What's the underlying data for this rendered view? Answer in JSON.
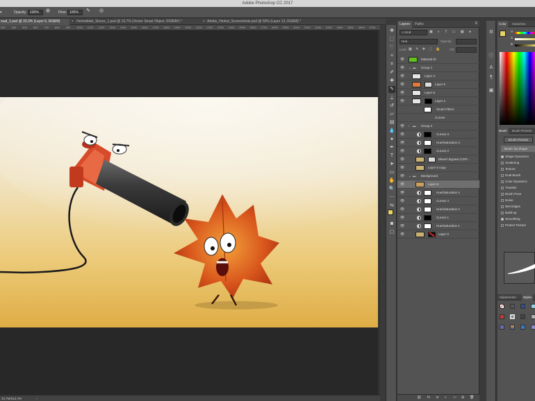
{
  "app": {
    "title": "Adobe Photoshop CC 2017"
  },
  "options": {
    "opacity_label": "Opacity:",
    "opacity_value": "100%",
    "flow_label": "Flow:",
    "flow_value": "100%"
  },
  "doctabs": [
    {
      "label": "xual_1.psd @ 33,3% (Layer 6, RGB/8)",
      "active": true
    },
    {
      "label": "Herbstblatt_Skizze_1.psd @ 16,7% (Vector Smart Object, RGB/8#) *",
      "active": false
    },
    {
      "label": "Adobe_Herbst_Screenshots.psd @ 50% (Layer 13, RGB/8) *",
      "active": false
    }
  ],
  "ruler": [
    "350",
    "400",
    "500",
    "600",
    "700",
    "800",
    "900",
    "1000",
    "1100",
    "1200",
    "1300",
    "1400",
    "1500",
    "1600",
    "1700",
    "1800",
    "1900",
    "2000",
    "2100",
    "2200",
    "2300",
    "2400",
    "2500",
    "2600",
    "2700",
    "2800",
    "2900",
    "3000",
    "3100",
    "3200",
    "3300",
    "3400",
    "3500",
    "3600",
    "3700"
  ],
  "status": {
    "size": "23,7M/313,7M"
  },
  "layers_panel": {
    "tabs": [
      {
        "label": "Layers",
        "active": true
      },
      {
        "label": "Paths",
        "active": false
      }
    ],
    "filter_kind": "Kind",
    "blend_mode": "Hue",
    "opacity_label": "Opacity:",
    "lock_label": "Lock:",
    "fill_label": "Fill:",
    "layers": [
      {
        "name": "Material ID",
        "type": "fill",
        "thumb": "#62c21f"
      },
      {
        "name": "Group 1",
        "type": "group"
      },
      {
        "name": "Layer 4",
        "type": "pixel",
        "thumb": "checker"
      },
      {
        "name": "Layer 5",
        "type": "pixel",
        "thumb": "#e07a3a",
        "mask": true
      },
      {
        "name": "Layer 6",
        "type": "pixel",
        "thumb": "checker"
      },
      {
        "name": "Layer 2",
        "type": "pixel",
        "thumb": "checker",
        "mask": true,
        "mask_black": true
      },
      {
        "name": "Smart Filters",
        "type": "sub"
      },
      {
        "name": "Curves",
        "type": "subfilter"
      },
      {
        "name": "Group 2",
        "type": "group"
      },
      {
        "name": "Curves 3",
        "type": "adj",
        "mask_black": true
      },
      {
        "name": "Hue/Saturation 3",
        "type": "adj"
      },
      {
        "name": "Curves 2",
        "type": "adj",
        "mask_black": true
      },
      {
        "name": "Bleach Bypass (CEP...",
        "type": "pixel",
        "thumb": "#c9b171",
        "mask": true
      },
      {
        "name": "Layer 0 copy",
        "type": "pixel",
        "thumb": "#c9b171"
      },
      {
        "name": "Background",
        "type": "group"
      },
      {
        "name": "Layer 6",
        "type": "pixel",
        "thumb": "#c9a060",
        "selected": true
      },
      {
        "name": "Hue/Saturation 4",
        "type": "adj"
      },
      {
        "name": "Curves 4",
        "type": "adj"
      },
      {
        "name": "Hue/Saturation 2",
        "type": "adj"
      },
      {
        "name": "Curves 1",
        "type": "adj",
        "mask_black": true
      },
      {
        "name": "Hue/Saturation 1",
        "type": "adj"
      },
      {
        "name": "Layer 0",
        "type": "pixel",
        "thumb": "#c9b171",
        "mask": true,
        "mask_red": true
      }
    ]
  },
  "color_panel": {
    "tabs": [
      {
        "label": "Color",
        "active": true
      },
      {
        "label": "Swatches",
        "active": false
      }
    ],
    "channels": [
      "H",
      "S",
      "B"
    ],
    "foreground": "#e6d36a"
  },
  "brush_panel": {
    "tabs": [
      {
        "label": "Brush",
        "active": true
      },
      {
        "label": "Brush Presets",
        "active": false
      }
    ],
    "presets_button": "Brush Presets",
    "tip_shape": "Brush Tip Shape",
    "options": [
      {
        "label": "Shape Dynamics",
        "checked": true
      },
      {
        "label": "Scattering",
        "checked": false
      },
      {
        "label": "Texture",
        "checked": false
      },
      {
        "label": "Dual Brush",
        "checked": false
      },
      {
        "label": "Color Dynamics",
        "checked": false
      },
      {
        "label": "Transfer",
        "checked": false
      },
      {
        "label": "Brush Pose",
        "checked": false
      },
      {
        "label": "Noise",
        "checked": false
      },
      {
        "label": "Wet Edges",
        "checked": false
      },
      {
        "label": "Build-up",
        "checked": false
      },
      {
        "label": "Smoothing",
        "checked": true
      },
      {
        "label": "Protect Texture",
        "checked": false
      }
    ]
  },
  "adjustments_panel": {
    "tabs": [
      {
        "label": "Adjustments",
        "active": false
      },
      {
        "label": "Styles",
        "active": true
      }
    ]
  }
}
